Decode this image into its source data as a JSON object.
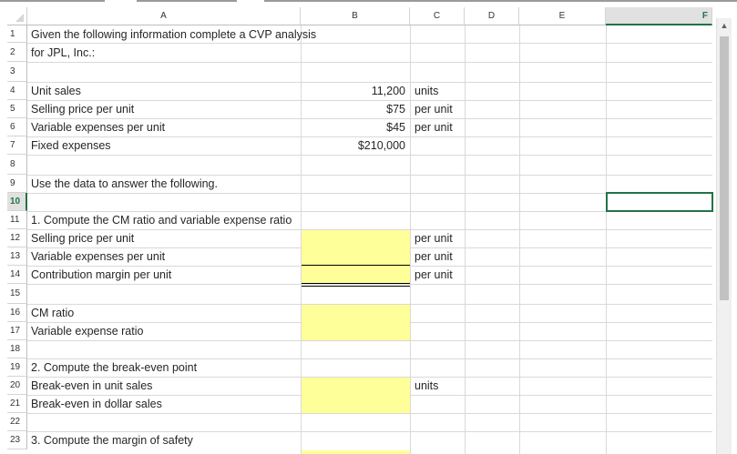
{
  "columns": [
    "A",
    "B",
    "C",
    "D",
    "E",
    "F"
  ],
  "selected_column": "F",
  "rows": [
    "1",
    "2",
    "3",
    "4",
    "5",
    "6",
    "7",
    "8",
    "9",
    "10",
    "11",
    "12",
    "13",
    "14",
    "15",
    "16",
    "17",
    "18",
    "19",
    "20",
    "21",
    "22",
    "23"
  ],
  "selected_row": "10",
  "cells": {
    "a1": "Given the following information complete a CVP analysis",
    "a2": "for JPL, Inc.:",
    "a4": "Unit sales",
    "b4": "11,200",
    "c4": "units",
    "a5": "Selling price per unit",
    "b5": "$75",
    "c5": "per unit",
    "a6": "Variable expenses per unit",
    "b6": "$45",
    "c6": "per unit",
    "a7": "Fixed expenses",
    "b7": "$210,000",
    "a9": "Use the data to answer the following.",
    "a11": "1. Compute the CM ratio and variable expense ratio",
    "a12": "Selling price per unit",
    "c12": "per unit",
    "a13": "Variable expenses per unit",
    "c13": "per unit",
    "a14": "Contribution margin per unit",
    "c14": "per unit",
    "a16": "CM ratio",
    "a17": "Variable expense ratio",
    "a19": "2. Compute the break-even point",
    "a20": "Break-even in unit sales",
    "c20": "units",
    "a21": "Break-even in dollar sales",
    "a23": "3. Compute the margin of safety"
  },
  "input_fill_color": "#ffff99",
  "selection_color": "#217346",
  "scrollbar": {
    "up_arrow": "▲"
  }
}
